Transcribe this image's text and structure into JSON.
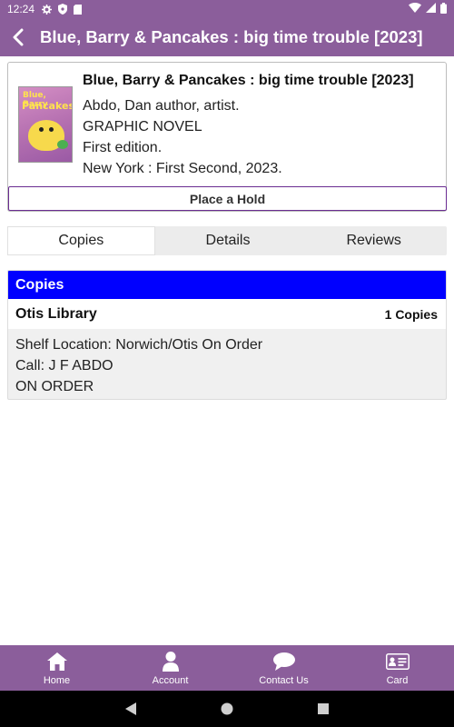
{
  "status_bar": {
    "time": "12:24"
  },
  "app_bar": {
    "title": "Blue, Barry & Pancakes : big time trouble [2023]"
  },
  "book": {
    "title": "Blue, Barry & Pancakes : big time trouble [2023]",
    "author": "Abdo, Dan author, artist.",
    "format": "GRAPHIC NOVEL",
    "edition": "First edition.",
    "publisher": "New York : First Second, 2023.",
    "cover": {
      "line1": "Blue, Barry",
      "line2": "Pancakes"
    },
    "hold_label": "Place a Hold"
  },
  "tabs": [
    {
      "label": "Copies",
      "active": true
    },
    {
      "label": "Details",
      "active": false
    },
    {
      "label": "Reviews",
      "active": false
    }
  ],
  "copies": {
    "header": "Copies",
    "library": "Otis Library",
    "count": "1 Copies",
    "shelf_location": "Shelf Location: Norwich/Otis On Order",
    "call": "Call: J F ABDO",
    "status": "ON ORDER"
  },
  "bottom_nav": [
    {
      "label": "Home",
      "icon": "home-icon"
    },
    {
      "label": "Account",
      "icon": "account-icon"
    },
    {
      "label": "Contact Us",
      "icon": "chat-icon"
    },
    {
      "label": "Card",
      "icon": "card-icon"
    }
  ],
  "colors": {
    "brand": "#8b5e9b",
    "copies_header": "#0000ff",
    "hold_border": "#6a2c91"
  }
}
